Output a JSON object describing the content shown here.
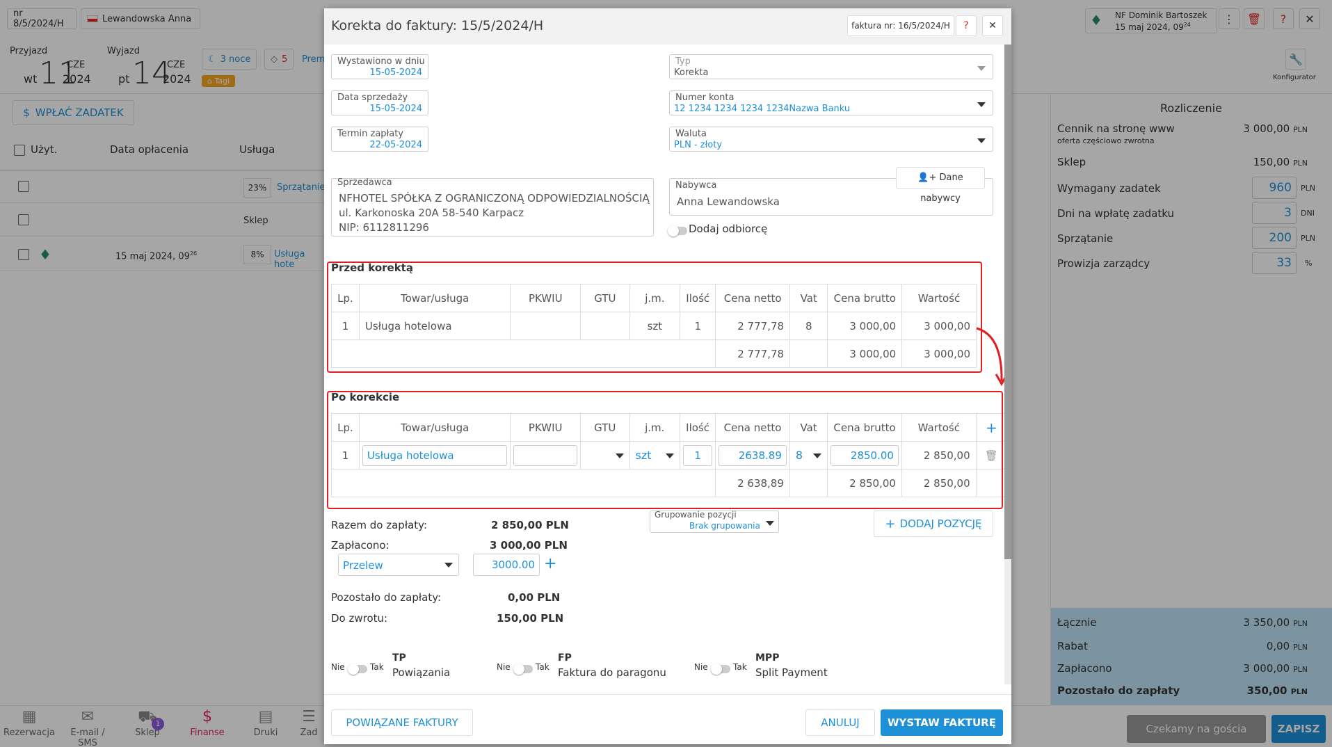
{
  "topbar": {
    "booking_no": "nr 8/5/2024/H",
    "guest": "Lewandowska Anna",
    "arrival_label": "Przyjazd",
    "arrival_dow": "wt",
    "arrival_day": "11",
    "arrival_month": "CZE",
    "arrival_year": "2024",
    "departure_label": "Wyjazd",
    "departure_dow": "pt",
    "departure_day": "14",
    "departure_month": "CZE",
    "departure_year": "2024",
    "nights": "3 noce",
    "tags_count": "5",
    "prem": "Prem",
    "tag_badge": "Tagi",
    "user_name": "NF Dominik Bartoszek",
    "user_date": "15 maj 2024, 09",
    "user_date_sup": "24",
    "configurator": "Konfigurator"
  },
  "left": {
    "deposit_button": "WPŁAĆ ZADATEK",
    "col_user": "Użyt.",
    "col_paid_date": "Data opłacenia",
    "col_service": "Usługa",
    "rows": [
      {
        "date": "",
        "pct": "23%",
        "service": "Sprzątanie"
      },
      {
        "date": "",
        "pct": "",
        "service": "Sklep"
      },
      {
        "date": "15 maj 2024, 09",
        "date_sup": "26",
        "pct": "8%",
        "service": "Usługa hote"
      }
    ]
  },
  "right_panel": {
    "title": "Rozliczenie",
    "rows": [
      {
        "label": "Cennik na stronę www",
        "sub": "oferta częściowo zwrotna",
        "value": "3 000,00",
        "unit": "PLN"
      },
      {
        "label": "Sklep",
        "value": "150,00",
        "unit": "PLN"
      },
      {
        "label": "Wymagany zadatek",
        "value": "960",
        "unit": "PLN"
      },
      {
        "label": "Dni na wpłatę zadatku",
        "value": "3",
        "unit": "DNI"
      },
      {
        "label": "Sprzątanie",
        "value": "200",
        "unit": "PLN"
      },
      {
        "label": "Prowizja zarządcy",
        "value": "33",
        "unit": "%"
      }
    ],
    "summary": [
      {
        "label": "Łącznie",
        "value": "3 350,00",
        "unit": "PLN"
      },
      {
        "label": "Rabat",
        "value": "0,00",
        "unit": "PLN"
      },
      {
        "label": "Zapłacono",
        "value": "3 000,00",
        "unit": "PLN"
      },
      {
        "label": "Pozostało do zapłaty",
        "value": "350,00",
        "unit": "PLN"
      }
    ],
    "wait_button": "Czekamy na gościa",
    "save_button": "ZAPISZ"
  },
  "bottom_nav": [
    {
      "label": "Rezerwacja",
      "icon": "calendar-icon"
    },
    {
      "label": "E-mail / SMS",
      "icon": "mail-icon"
    },
    {
      "label": "Sklep",
      "icon": "cart-icon",
      "badge": "1"
    },
    {
      "label": "Finanse",
      "icon": "dollar-icon"
    },
    {
      "label": "Druki",
      "icon": "document-icon"
    },
    {
      "label": "Zad",
      "icon": "tasks-icon"
    }
  ],
  "modal": {
    "title": "Korekta do faktury: 15/5/2024/H",
    "invoice_ref": "faktura nr: 16/5/2024/H",
    "issued_label": "Wystawiono w dniu",
    "issued_value": "15-05-2024",
    "sale_label": "Data sprzedaży",
    "sale_value": "15-05-2024",
    "due_label": "Termin zapłaty",
    "due_value": "22-05-2024",
    "type_label": "Typ",
    "type_value": "Korekta",
    "account_label": "Numer konta",
    "account_value": "12 1234 1234 1234 1234Nazwa Banku",
    "currency_label": "Waluta",
    "currency_value": "PLN - złoty",
    "seller_label": "Sprzedawca",
    "seller_lines": [
      "NFHOTEL SPÓŁKA Z OGRANICZONĄ ODPOWIEDZIALNOŚCIĄ",
      "ul. Karkonoska 20A 58-540 Karpacz",
      "NIP: 6112811296"
    ],
    "buyer_label": "Nabywca",
    "buyer_value": "Anna Lewandowska",
    "buyer_button": "Dane nabywcy",
    "add_recipient": "Dodaj odbiorcę",
    "before_title": "Przed korektą",
    "after_title": "Po korekcie",
    "headers": [
      "Lp.",
      "Towar/usługa",
      "PKWIU",
      "GTU",
      "j.m.",
      "Ilość",
      "Cena netto",
      "Vat",
      "Cena brutto",
      "Wartość"
    ],
    "before_row": [
      "1",
      "Usługa hotelowa",
      "",
      "",
      "szt",
      "1",
      "2 777,78",
      "8",
      "3 000,00",
      "3 000,00"
    ],
    "before_total": {
      "netto": "2 777,78",
      "brutto": "3 000,00",
      "value": "3 000,00"
    },
    "after_row": {
      "lp": "1",
      "name": "Usługa hotelowa",
      "pkwiu": "",
      "unit": "szt",
      "qty": "1",
      "netto": "2638.89",
      "vat": "8",
      "brutto": "2850.00",
      "value": "2 850,00"
    },
    "after_total": {
      "netto": "2 638,89",
      "brutto": "2 850,00",
      "value": "2 850,00"
    },
    "total_due_label": "Razem do zapłaty:",
    "total_due_value": "2 850,00 PLN",
    "paid_label": "Zapłacono:",
    "paid_value": "3 000,00 PLN",
    "payment_method": "Przelew",
    "payment_amount": "3000.00",
    "remaining_label": "Pozostało do zapłaty:",
    "remaining_value": "0,00 PLN",
    "refund_label": "Do zwrotu:",
    "refund_value": "150,00 PLN",
    "grouping_label": "Grupowanie pozycji",
    "grouping_value": "Brak grupowania",
    "add_position": "DODAJ POZYCJĘ",
    "toggles": [
      {
        "no": "Nie",
        "yes": "Tak",
        "code": "TP",
        "label": "Powiązania"
      },
      {
        "no": "Nie",
        "yes": "Tak",
        "code": "FP",
        "label": "Faktura do paragonu"
      },
      {
        "no": "Nie",
        "yes": "Tak",
        "code": "MPP",
        "label": "Split Payment"
      }
    ],
    "related_button": "POWIĄZANE FAKTURY",
    "cancel_button": "ANULUJ",
    "issue_button": "WYSTAW FAKTURĘ"
  }
}
